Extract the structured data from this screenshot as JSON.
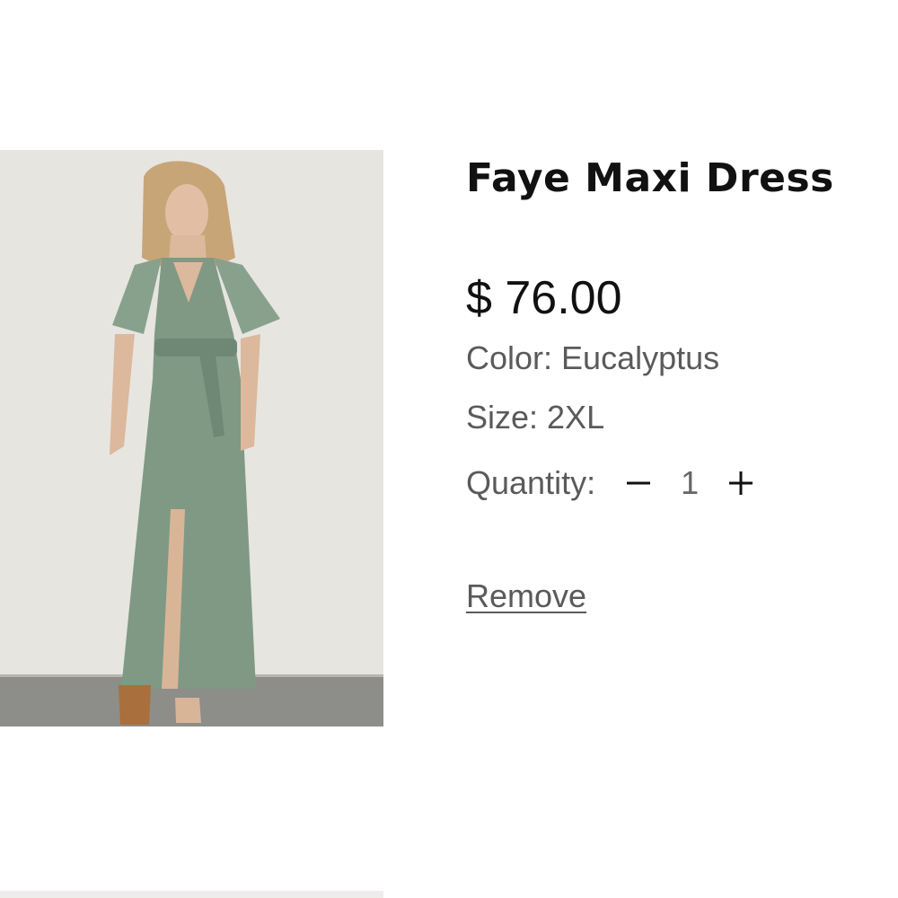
{
  "product": {
    "title": "Faye Maxi Dress",
    "price": "$ 76.00",
    "color": "Color: Eucalyptus",
    "size": "Size: 2XL",
    "quantity_label": "Quantity:",
    "quantity": "1",
    "remove_label": "Remove",
    "image_icon": "product-photo-green-maxi-dress"
  },
  "colors": {
    "text_primary": "#111111",
    "text_secondary": "#5a5a5a",
    "dress_green": "#7f9985",
    "background": "#ffffff"
  }
}
